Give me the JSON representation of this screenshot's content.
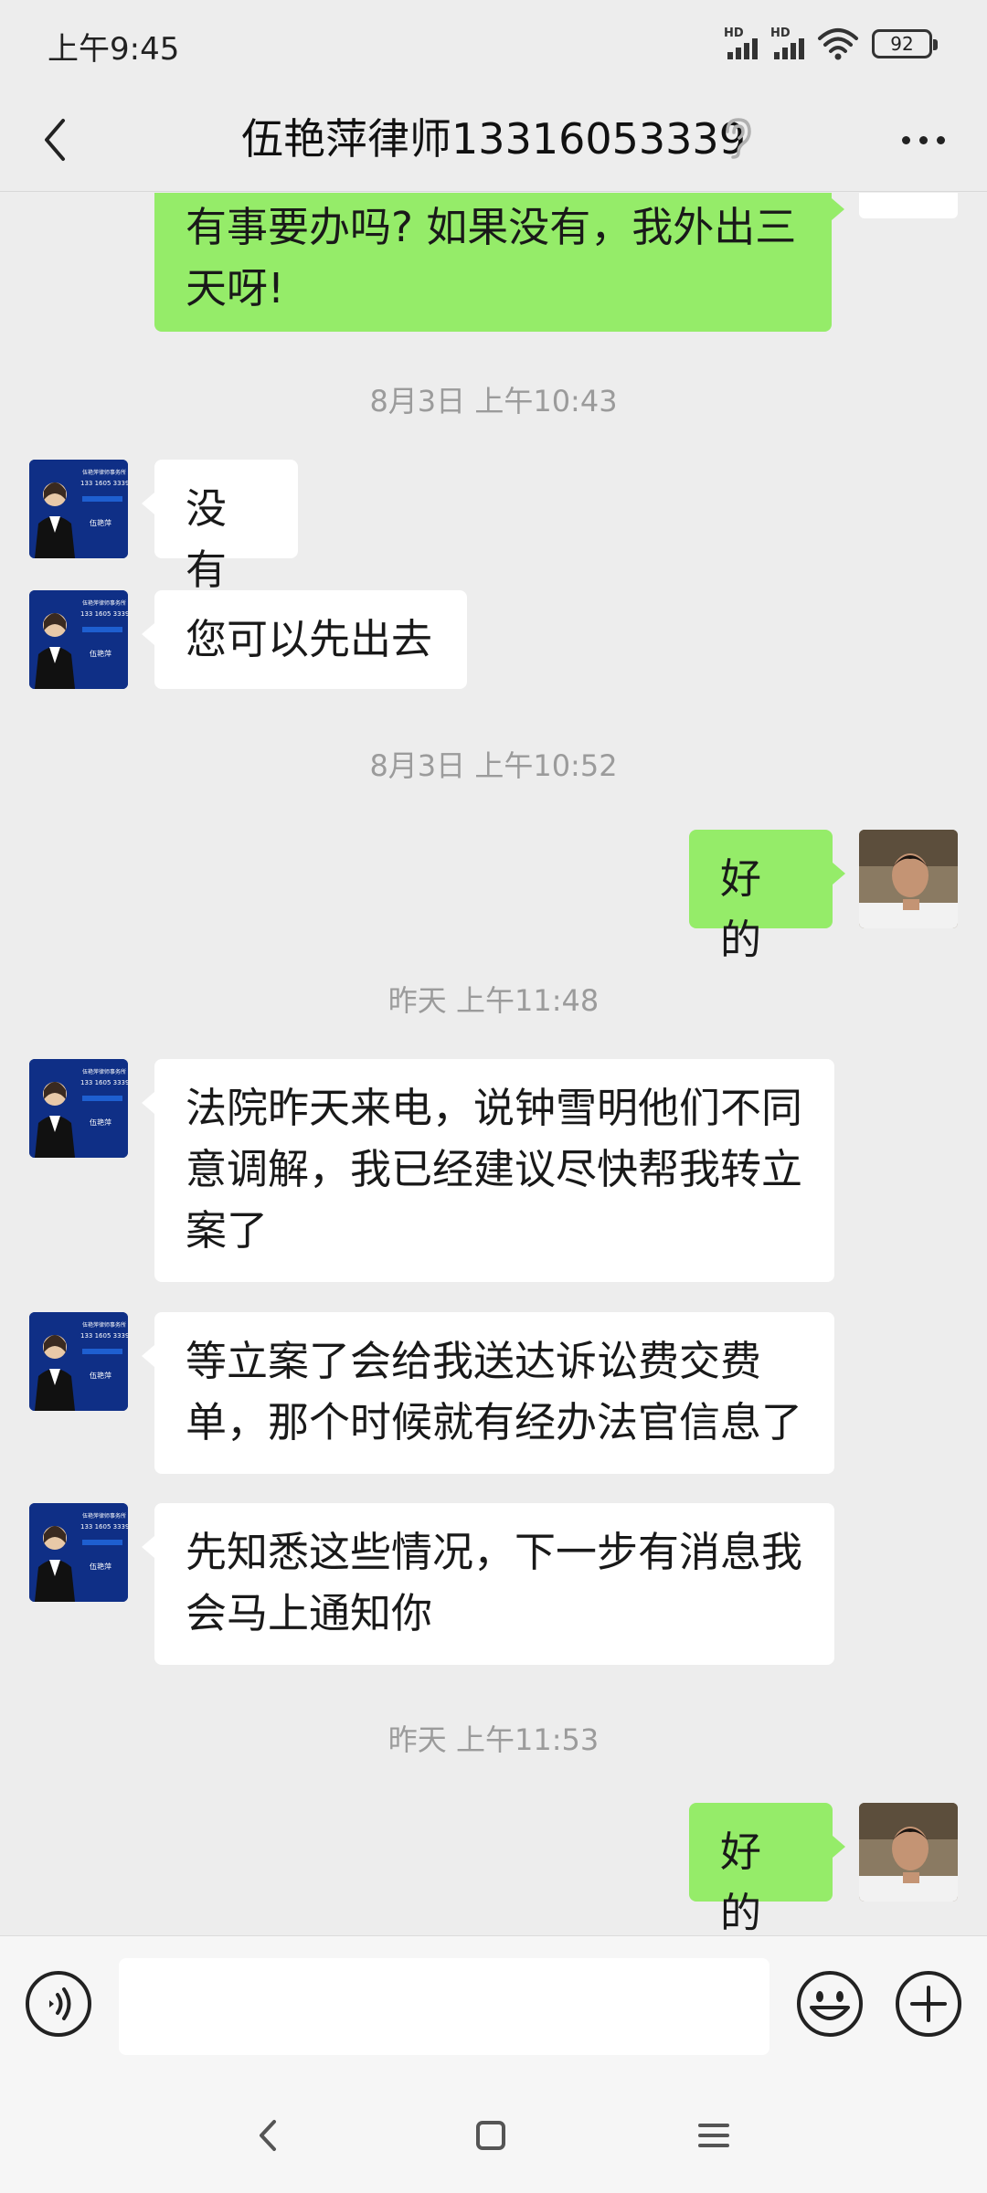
{
  "status_bar": {
    "time": "上午9:45",
    "signal1_label": "HD",
    "signal2_label": "HD",
    "battery": "92"
  },
  "header": {
    "title": "伍艳萍律师13316053339",
    "back_icon": "chevron-left-icon",
    "ear_icon": "ear-icon",
    "more_icon": "more-dots-icon"
  },
  "messages": [
    {
      "type": "text",
      "side": "right",
      "lines": [
        "有事要办吗? 如果没有，我外出三",
        "天呀!"
      ]
    },
    {
      "type": "time",
      "text": "8月3日 上午10:43"
    },
    {
      "type": "text",
      "side": "left",
      "lines": [
        "没有"
      ]
    },
    {
      "type": "text",
      "side": "left",
      "lines": [
        "您可以先出去"
      ]
    },
    {
      "type": "time",
      "text": "8月3日 上午10:52"
    },
    {
      "type": "text",
      "side": "right",
      "lines": [
        "好的"
      ]
    },
    {
      "type": "time",
      "text": "昨天 上午11:48"
    },
    {
      "type": "text",
      "side": "left",
      "lines": [
        "法院昨天来电，说钟雪明他们不同",
        "意调解，我已经建议尽快帮我转立",
        "案了"
      ]
    },
    {
      "type": "text",
      "side": "left",
      "lines": [
        "等立案了会给我送达诉讼费交费",
        "单，那个时候就有经办法官信息了"
      ]
    },
    {
      "type": "text",
      "side": "left",
      "lines": [
        "先知悉这些情况，下一步有消息我",
        "会马上通知你"
      ]
    },
    {
      "type": "time",
      "text": "昨天 上午11:53"
    },
    {
      "type": "text",
      "side": "right",
      "lines": [
        "好的"
      ]
    }
  ],
  "lawyer_avatar": {
    "line1": "伍艳萍律师事务所",
    "line2": "133 1605 3339",
    "line3": "伍艳萍"
  },
  "input_bar": {
    "value": "",
    "voice_icon": "voice-icon",
    "emoji_icon": "emoji-icon",
    "plus_icon": "plus-icon"
  },
  "nav_bar": {
    "back_icon": "nav-back-icon",
    "home_icon": "nav-home-icon",
    "menu_icon": "nav-menu-icon"
  },
  "colors": {
    "background": "#ededed",
    "bubble_self": "#95ec69",
    "bubble_other": "#ffffff",
    "timestamp": "#9b9b9b"
  }
}
